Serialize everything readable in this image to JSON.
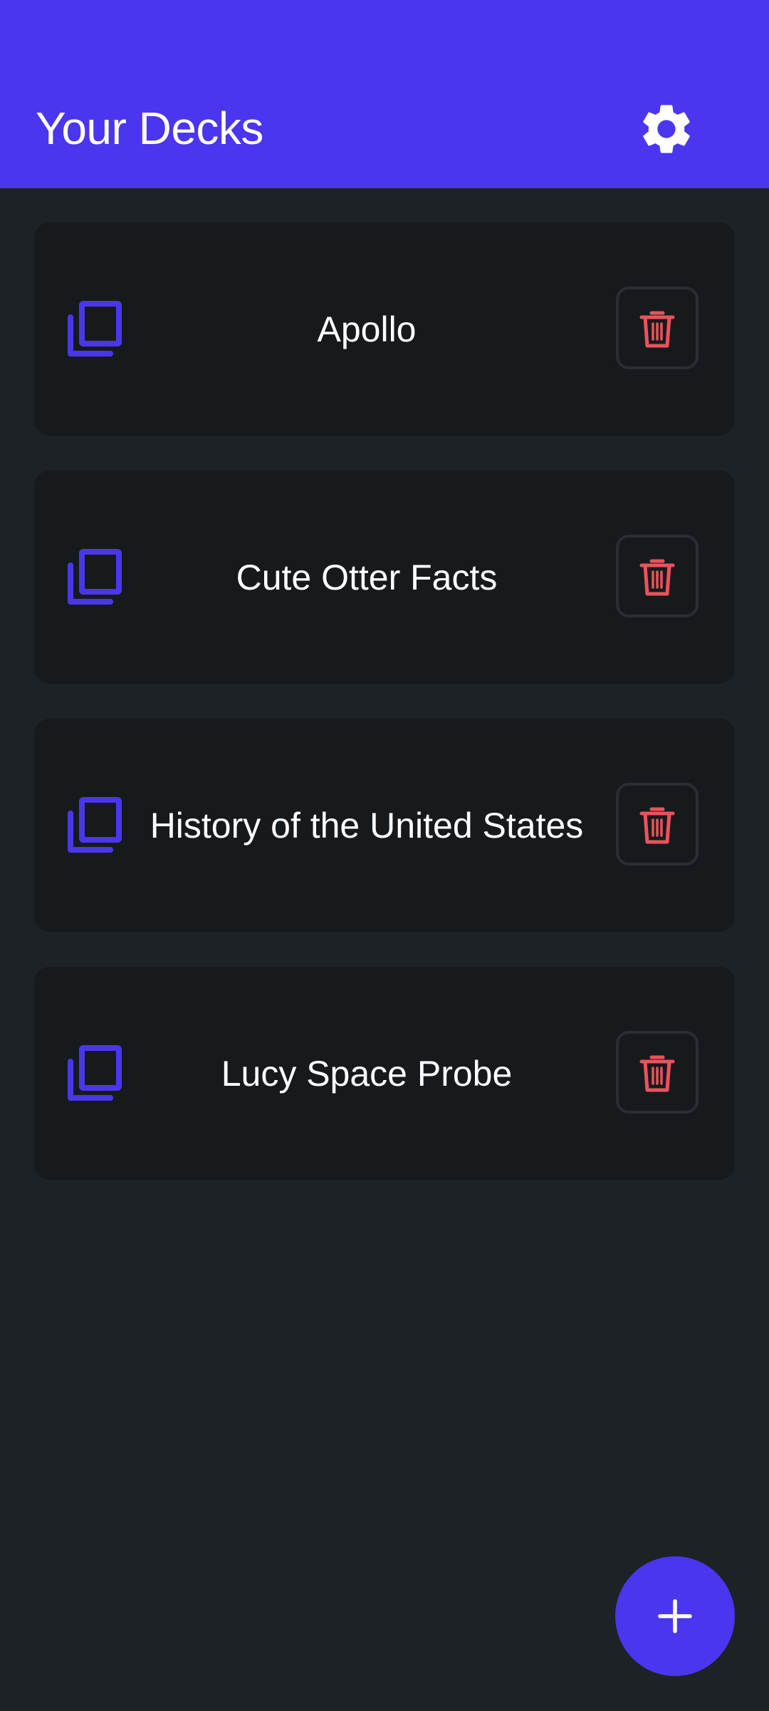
{
  "header": {
    "title": "Your Decks",
    "settings_icon": "gear-icon",
    "background": "#4b36ef"
  },
  "decks": [
    {
      "title": "Apollo",
      "icon": "copy-icon",
      "delete_icon": "trash-icon"
    },
    {
      "title": "Cute Otter Facts",
      "icon": "copy-icon",
      "delete_icon": "trash-icon"
    },
    {
      "title": "History of the United States",
      "icon": "copy-icon",
      "delete_icon": "trash-icon"
    },
    {
      "title": "Lucy Space Probe",
      "icon": "copy-icon",
      "delete_icon": "trash-icon"
    }
  ],
  "fab": {
    "icon": "plus-icon"
  },
  "colors": {
    "accent": "#4b36ef",
    "danger": "#e8545a",
    "background": "#1d2226",
    "card": "#171a1d",
    "text": "#ffffff"
  }
}
